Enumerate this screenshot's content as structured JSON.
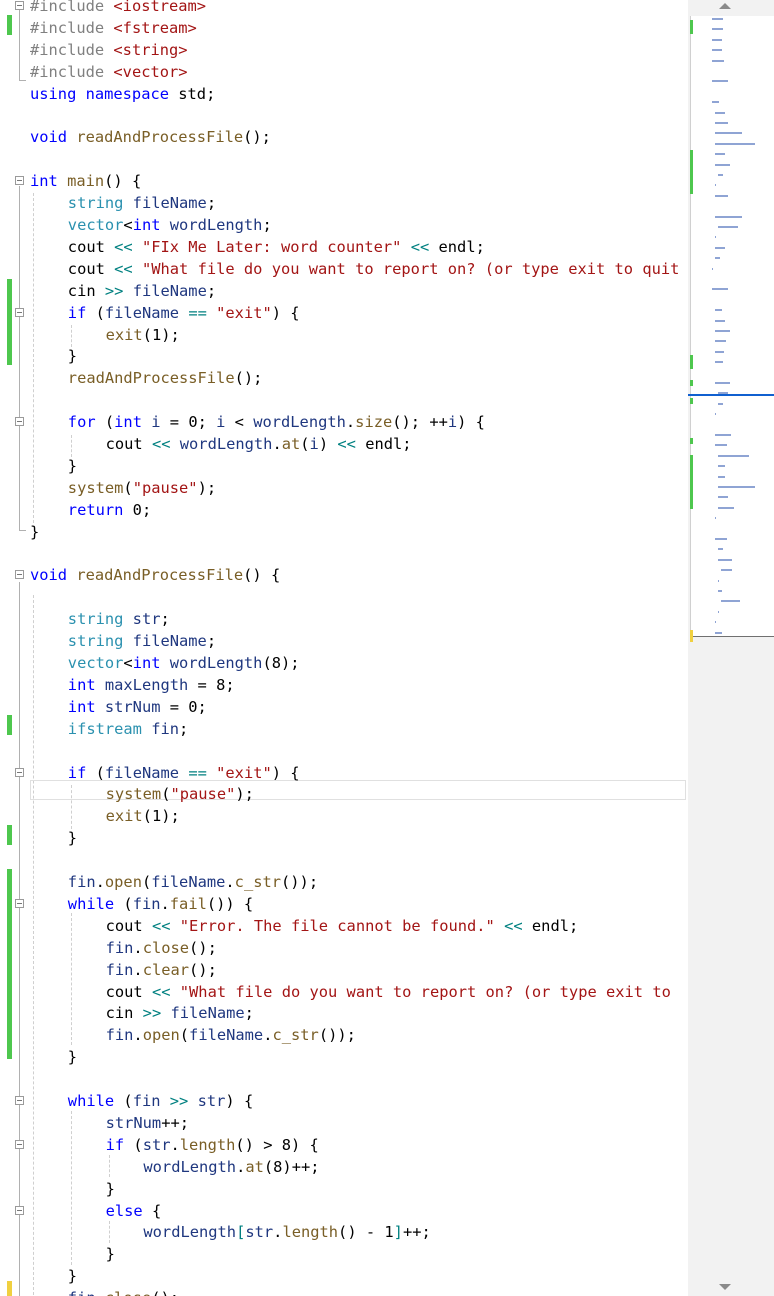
{
  "code": {
    "lines": [
      {
        "row": 0,
        "indent": 0,
        "tokens": [
          [
            "pp",
            "#include "
          ],
          [
            "st",
            "<iostream>"
          ]
        ]
      },
      {
        "row": 1,
        "indent": 0,
        "tokens": [
          [
            "pp",
            "#include "
          ],
          [
            "st",
            "<fstream>"
          ]
        ]
      },
      {
        "row": 2,
        "indent": 0,
        "tokens": [
          [
            "pp",
            "#include "
          ],
          [
            "st",
            "<string>"
          ]
        ]
      },
      {
        "row": 3,
        "indent": 0,
        "tokens": [
          [
            "pp",
            "#include "
          ],
          [
            "st",
            "<vector>"
          ]
        ]
      },
      {
        "row": 4,
        "indent": 0,
        "tokens": [
          [
            "kw",
            "using namespace "
          ],
          [
            "",
            "std;"
          ]
        ]
      },
      {
        "row": 5,
        "indent": 0,
        "tokens": []
      },
      {
        "row": 6,
        "indent": 0,
        "tokens": [
          [
            "kw",
            "void "
          ],
          [
            "fn",
            "readAndProcessFile"
          ],
          [
            "",
            "();"
          ]
        ]
      },
      {
        "row": 7,
        "indent": 0,
        "tokens": []
      },
      {
        "row": 8,
        "indent": 0,
        "tokens": [
          [
            "kw",
            "int "
          ],
          [
            "fn",
            "main"
          ],
          [
            "",
            "() {"
          ]
        ]
      },
      {
        "row": 9,
        "indent": 1,
        "tokens": [
          [
            "ty",
            "string "
          ],
          [
            "va",
            "fileName"
          ],
          [
            "",
            ";"
          ]
        ]
      },
      {
        "row": 10,
        "indent": 1,
        "tokens": [
          [
            "ty",
            "vector"
          ],
          [
            "",
            "<"
          ],
          [
            "kw",
            "int"
          ],
          [
            ">",
            " "
          ],
          [
            "va",
            "wordLength"
          ],
          [
            "",
            ";"
          ]
        ]
      },
      {
        "row": 11,
        "indent": 1,
        "tokens": [
          [
            "",
            "cout "
          ],
          [
            "op",
            "<<"
          ],
          [
            "",
            " "
          ],
          [
            "st",
            "\"FIx Me Later: word counter\""
          ],
          [
            "",
            " "
          ],
          [
            "op",
            "<<"
          ],
          [
            "",
            " endl;"
          ]
        ]
      },
      {
        "row": 12,
        "indent": 1,
        "tokens": [
          [
            "",
            "cout "
          ],
          [
            "op",
            "<<"
          ],
          [
            "",
            " "
          ],
          [
            "st",
            "\"What file do you want to report on? (or type exit to quit"
          ]
        ]
      },
      {
        "row": 13,
        "indent": 1,
        "tokens": [
          [
            "",
            "cin "
          ],
          [
            "op",
            ">>"
          ],
          [
            "",
            " "
          ],
          [
            "va",
            "fileName"
          ],
          [
            "",
            ";"
          ]
        ]
      },
      {
        "row": 14,
        "indent": 1,
        "tokens": [
          [
            "kw",
            "if "
          ],
          [
            "",
            "("
          ],
          [
            "va",
            "fileName"
          ],
          [
            "",
            " "
          ],
          [
            "op",
            "=="
          ],
          [
            "",
            " "
          ],
          [
            "st",
            "\"exit\""
          ],
          [
            "",
            ") {"
          ]
        ]
      },
      {
        "row": 15,
        "indent": 2,
        "tokens": [
          [
            "fn",
            "exit"
          ],
          [
            "",
            "(1);"
          ]
        ]
      },
      {
        "row": 16,
        "indent": 1,
        "tokens": [
          [
            "",
            "}"
          ]
        ]
      },
      {
        "row": 17,
        "indent": 1,
        "tokens": [
          [
            "fn",
            "readAndProcessFile"
          ],
          [
            "",
            "();"
          ]
        ]
      },
      {
        "row": 18,
        "indent": 0,
        "tokens": []
      },
      {
        "row": 19,
        "indent": 1,
        "tokens": [
          [
            "kw",
            "for "
          ],
          [
            "",
            "("
          ],
          [
            "kw",
            "int "
          ],
          [
            "va",
            "i"
          ],
          [
            "",
            " = 0; "
          ],
          [
            "va",
            "i"
          ],
          [
            "",
            " < "
          ],
          [
            "va",
            "wordLength"
          ],
          [
            "",
            "."
          ],
          [
            "fn",
            "size"
          ],
          [
            "",
            "(); ++"
          ],
          [
            "va",
            "i"
          ],
          [
            "",
            ") {"
          ]
        ]
      },
      {
        "row": 20,
        "indent": 2,
        "tokens": [
          [
            "",
            "cout "
          ],
          [
            "op",
            "<<"
          ],
          [
            "",
            " "
          ],
          [
            "va",
            "wordLength"
          ],
          [
            "",
            "."
          ],
          [
            "fn",
            "at"
          ],
          [
            "",
            "("
          ],
          [
            "va",
            "i"
          ],
          [
            "",
            ") "
          ],
          [
            "op",
            "<<"
          ],
          [
            "",
            " endl;"
          ]
        ]
      },
      {
        "row": 21,
        "indent": 1,
        "tokens": [
          [
            "",
            "}"
          ]
        ]
      },
      {
        "row": 22,
        "indent": 1,
        "tokens": [
          [
            "fn",
            "system"
          ],
          [
            "",
            "("
          ],
          [
            "st",
            "\"pause\""
          ],
          [
            "",
            ");"
          ]
        ]
      },
      {
        "row": 23,
        "indent": 1,
        "tokens": [
          [
            "kw",
            "return "
          ],
          [
            "",
            "0;"
          ]
        ]
      },
      {
        "row": 24,
        "indent": 0,
        "tokens": [
          [
            "",
            "}"
          ]
        ]
      },
      {
        "row": 25,
        "indent": 0,
        "tokens": []
      },
      {
        "row": 26,
        "indent": 0,
        "tokens": [
          [
            "kw",
            "void "
          ],
          [
            "fn",
            "readAndProcessFile"
          ],
          [
            "",
            "() {"
          ]
        ]
      },
      {
        "row": 27,
        "indent": 0,
        "tokens": []
      },
      {
        "row": 28,
        "indent": 1,
        "tokens": [
          [
            "ty",
            "string "
          ],
          [
            "va",
            "str"
          ],
          [
            "",
            ";"
          ]
        ]
      },
      {
        "row": 29,
        "indent": 1,
        "tokens": [
          [
            "ty",
            "string "
          ],
          [
            "va",
            "fileName"
          ],
          [
            "",
            ";"
          ]
        ]
      },
      {
        "row": 30,
        "indent": 1,
        "tokens": [
          [
            "ty",
            "vector"
          ],
          [
            "",
            "<"
          ],
          [
            "kw",
            "int"
          ],
          [
            ">",
            " "
          ],
          [
            "va",
            "wordLength"
          ],
          [
            "",
            "(8);"
          ]
        ]
      },
      {
        "row": 31,
        "indent": 1,
        "tokens": [
          [
            "kw",
            "int "
          ],
          [
            "va",
            "maxLength"
          ],
          [
            "",
            " = 8;"
          ]
        ]
      },
      {
        "row": 32,
        "indent": 1,
        "tokens": [
          [
            "kw",
            "int "
          ],
          [
            "va",
            "strNum"
          ],
          [
            "",
            " = 0;"
          ]
        ]
      },
      {
        "row": 33,
        "indent": 1,
        "tokens": [
          [
            "ty",
            "ifstream "
          ],
          [
            "va",
            "fin"
          ],
          [
            "",
            ";"
          ]
        ]
      },
      {
        "row": 34,
        "indent": 0,
        "tokens": []
      },
      {
        "row": 35,
        "indent": 1,
        "tokens": [
          [
            "kw",
            "if "
          ],
          [
            "",
            "("
          ],
          [
            "va",
            "fileName"
          ],
          [
            "",
            " "
          ],
          [
            "op",
            "=="
          ],
          [
            "",
            " "
          ],
          [
            "st",
            "\"exit\""
          ],
          [
            "",
            ") {"
          ]
        ]
      },
      {
        "row": 36,
        "indent": 2,
        "tokens": [
          [
            "fn",
            "system"
          ],
          [
            "",
            "("
          ],
          [
            "st",
            "\"pause\""
          ],
          [
            "",
            ");"
          ]
        ]
      },
      {
        "row": 37,
        "indent": 2,
        "tokens": [
          [
            "fn",
            "exit"
          ],
          [
            "",
            "(1);"
          ]
        ]
      },
      {
        "row": 38,
        "indent": 1,
        "tokens": [
          [
            "",
            "}"
          ]
        ]
      },
      {
        "row": 39,
        "indent": 0,
        "tokens": []
      },
      {
        "row": 40,
        "indent": 1,
        "tokens": [
          [
            "va",
            "fin"
          ],
          [
            "",
            "."
          ],
          [
            "fn",
            "open"
          ],
          [
            "",
            "("
          ],
          [
            "va",
            "fileName"
          ],
          [
            "",
            "."
          ],
          [
            "fn",
            "c_str"
          ],
          [
            "",
            "());"
          ]
        ]
      },
      {
        "row": 41,
        "indent": 1,
        "tokens": [
          [
            "kw",
            "while "
          ],
          [
            "",
            "("
          ],
          [
            "va",
            "fin"
          ],
          [
            "",
            "."
          ],
          [
            "fn",
            "fail"
          ],
          [
            "",
            "()) {"
          ]
        ]
      },
      {
        "row": 42,
        "indent": 2,
        "tokens": [
          [
            "",
            "cout "
          ],
          [
            "op",
            "<<"
          ],
          [
            "",
            " "
          ],
          [
            "st",
            "\"Error. The file cannot be found.\""
          ],
          [
            "",
            " "
          ],
          [
            "op",
            "<<"
          ],
          [
            "",
            " endl;"
          ]
        ]
      },
      {
        "row": 43,
        "indent": 2,
        "tokens": [
          [
            "va",
            "fin"
          ],
          [
            "",
            "."
          ],
          [
            "fn",
            "close"
          ],
          [
            "",
            "();"
          ]
        ]
      },
      {
        "row": 44,
        "indent": 2,
        "tokens": [
          [
            "va",
            "fin"
          ],
          [
            "",
            "."
          ],
          [
            "fn",
            "clear"
          ],
          [
            "",
            "();"
          ]
        ]
      },
      {
        "row": 45,
        "indent": 2,
        "tokens": [
          [
            "",
            "cout "
          ],
          [
            "op",
            "<<"
          ],
          [
            "",
            " "
          ],
          [
            "st",
            "\"What file do you want to report on? (or type exit to"
          ]
        ]
      },
      {
        "row": 46,
        "indent": 2,
        "tokens": [
          [
            "",
            "cin "
          ],
          [
            "op",
            ">>"
          ],
          [
            "",
            " "
          ],
          [
            "va",
            "fileName"
          ],
          [
            "",
            ";"
          ]
        ]
      },
      {
        "row": 47,
        "indent": 2,
        "tokens": [
          [
            "va",
            "fin"
          ],
          [
            "",
            "."
          ],
          [
            "fn",
            "open"
          ],
          [
            "",
            "("
          ],
          [
            "va",
            "fileName"
          ],
          [
            "",
            "."
          ],
          [
            "fn",
            "c_str"
          ],
          [
            "",
            "());"
          ]
        ]
      },
      {
        "row": 48,
        "indent": 1,
        "tokens": [
          [
            "",
            "}"
          ]
        ]
      },
      {
        "row": 49,
        "indent": 0,
        "tokens": []
      },
      {
        "row": 50,
        "indent": 1,
        "tokens": [
          [
            "kw",
            "while "
          ],
          [
            "",
            "("
          ],
          [
            "va",
            "fin"
          ],
          [
            "",
            " "
          ],
          [
            "op",
            ">>"
          ],
          [
            "",
            " "
          ],
          [
            "va",
            "str"
          ],
          [
            "",
            ") {"
          ]
        ]
      },
      {
        "row": 51,
        "indent": 2,
        "tokens": [
          [
            "va",
            "strNum"
          ],
          [
            "",
            "++;"
          ]
        ]
      },
      {
        "row": 52,
        "indent": 2,
        "tokens": [
          [
            "kw",
            "if "
          ],
          [
            "",
            "("
          ],
          [
            "va",
            "str"
          ],
          [
            "",
            "."
          ],
          [
            "fn",
            "length"
          ],
          [
            "",
            "() > 8) {"
          ]
        ]
      },
      {
        "row": 53,
        "indent": 3,
        "tokens": [
          [
            "va",
            "wordLength"
          ],
          [
            "",
            "."
          ],
          [
            "fn",
            "at"
          ],
          [
            "",
            "(8)++;"
          ]
        ]
      },
      {
        "row": 54,
        "indent": 2,
        "tokens": [
          [
            "",
            "}"
          ]
        ]
      },
      {
        "row": 55,
        "indent": 2,
        "tokens": [
          [
            "kw",
            "else "
          ],
          [
            "",
            "{"
          ]
        ]
      },
      {
        "row": 56,
        "indent": 3,
        "tokens": [
          [
            "va",
            "wordLength"
          ],
          [
            "op",
            "["
          ],
          [
            "va",
            "str"
          ],
          [
            "",
            "."
          ],
          [
            "fn",
            "length"
          ],
          [
            "",
            "() - 1"
          ],
          [
            "op",
            "]"
          ],
          [
            "",
            "++;"
          ]
        ]
      },
      {
        "row": 57,
        "indent": 2,
        "tokens": [
          [
            "",
            "}"
          ]
        ]
      },
      {
        "row": 58,
        "indent": 1,
        "tokens": [
          [
            "",
            "}"
          ]
        ]
      },
      {
        "row": 59,
        "indent": 1,
        "tokens": [
          [
            "va",
            "fin"
          ],
          [
            "",
            "."
          ],
          [
            "fn",
            "close"
          ],
          [
            "",
            "();"
          ]
        ]
      }
    ],
    "folds": [
      0,
      8,
      14,
      19,
      26,
      35,
      41,
      50,
      52,
      55
    ]
  },
  "minimap": {
    "scroll_up": "scroll-up-arrow",
    "scroll_down": "scroll-down-arrow"
  }
}
